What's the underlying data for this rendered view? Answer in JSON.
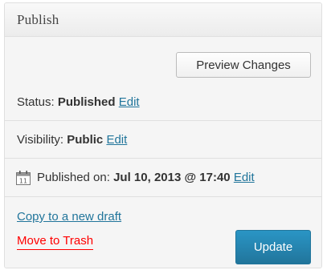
{
  "box": {
    "title": "Publish"
  },
  "preview_button": {
    "label": "Preview Changes"
  },
  "status": {
    "label": "Status: ",
    "value": "Published",
    "edit_label": "Edit"
  },
  "visibility": {
    "label": "Visibility: ",
    "value": "Public",
    "edit_label": "Edit"
  },
  "published_on": {
    "icon": "calendar-icon",
    "label": "Published on: ",
    "value": "Jul 10, 2013 @ 17:40",
    "edit_label": "Edit"
  },
  "actions": {
    "copy_label": "Copy to a new draft",
    "trash_label": "Move to Trash",
    "update_label": "Update"
  },
  "colors": {
    "link": "#21759b",
    "trash": "#ff0000",
    "primary_button": "#21759b",
    "panel_bg": "#f5f5f5"
  }
}
